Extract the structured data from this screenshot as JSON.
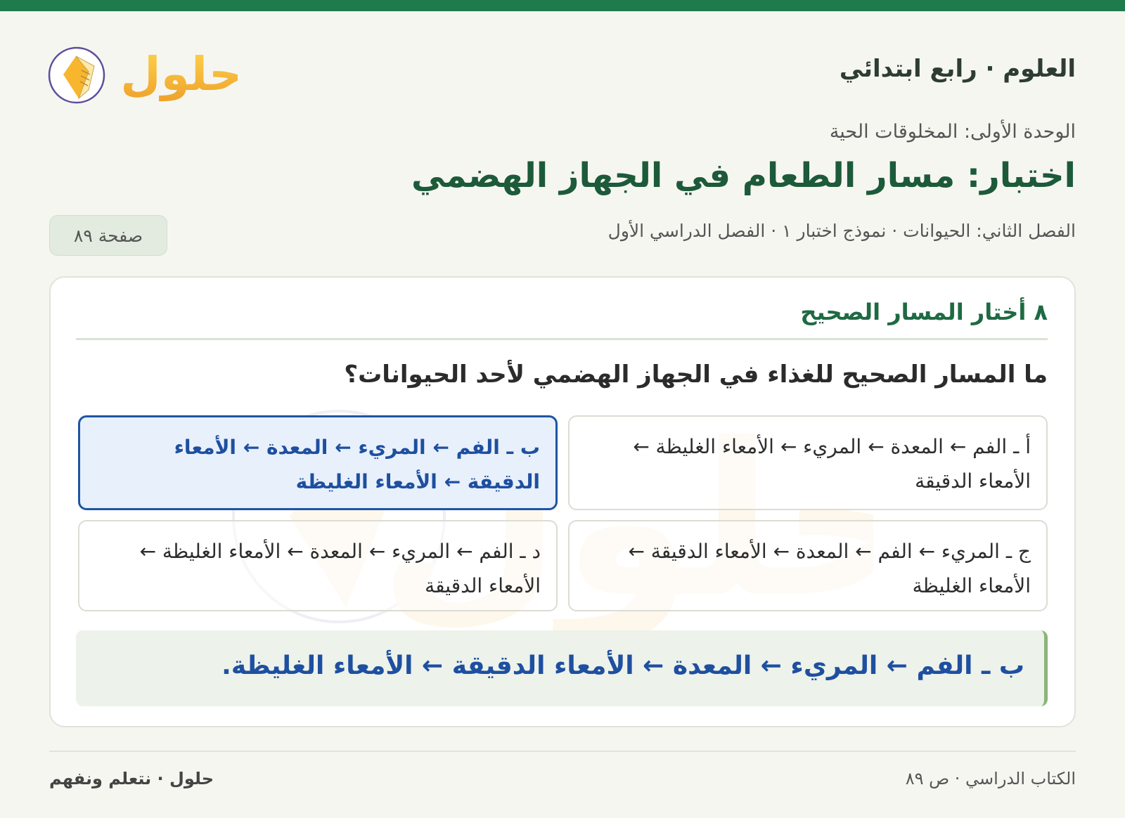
{
  "header": {
    "subject": "العلوم · رابع ابتدائي",
    "brand_logo": "حلول",
    "unit": "الوحدة الأولى: المخلوقات الحية",
    "title": "اختبار: مسار الطعام في الجهاز الهضمي",
    "meta": "الفصل الثاني: الحيوانات · نموذج اختبار ١ · الفصل الدراسي الأول",
    "page_badge": "صفحة ٨٩"
  },
  "question": {
    "section_heading": "٨ أختار المسار الصحيح",
    "text": "ما المسار الصحيح للغذاء في الجهاز الهضمي لأحد الحيوانات؟",
    "options": [
      {
        "label": "أ ـ الفم ← المعدة ← المريء ← الأمعاء الغليظة ← الأمعاء الدقيقة",
        "selected": false
      },
      {
        "label": "ب ـ الفم ← المريء ← المعدة ← الأمعاء الدقيقة ← الأمعاء الغليظة",
        "selected": true
      },
      {
        "label": "ج ـ المريء ← الفم ← المعدة ← الأمعاء الدقيقة ← الأمعاء الغليظة",
        "selected": false
      },
      {
        "label": "د ـ الفم ← المريء ← المعدة ← الأمعاء الغليظة ← الأمعاء الدقيقة",
        "selected": false
      }
    ],
    "answer": "ب ـ الفم ← المريء ← المعدة ← الأمعاء الدقيقة ← الأمعاء الغليظة."
  },
  "footer": {
    "right": "الكتاب الدراسي · ص ٨٩",
    "left": "حلول · نتعلم ونفهم"
  },
  "colors": {
    "top_bar": "#1f7a4c",
    "title": "#1d5a3a",
    "selected_border": "#1e55a4",
    "selected_bg": "#e8f0fb",
    "answer_bg": "#edf2ea",
    "answer_border": "#8ab57a",
    "logo_gold": "#f2b33a"
  },
  "icons": {
    "logo": "book-leaf-logo-icon"
  }
}
